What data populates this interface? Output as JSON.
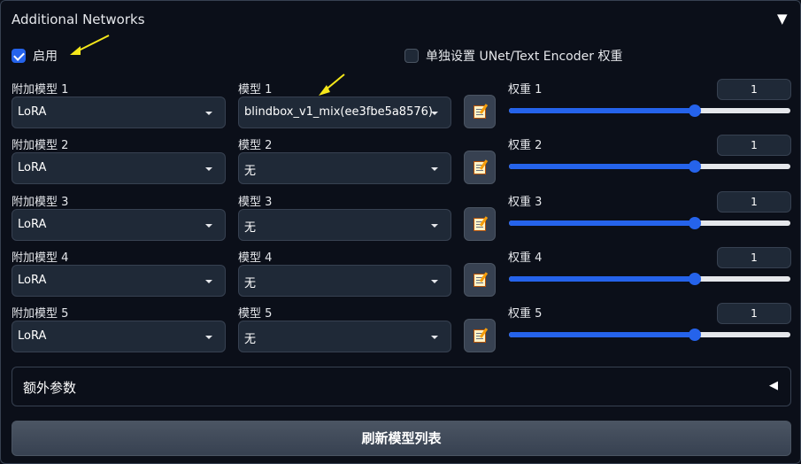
{
  "header": {
    "title": "Additional Networks",
    "collapse_glyph": "▼"
  },
  "enable": {
    "label": "启用",
    "checked": true
  },
  "separate_weights": {
    "label": "单独设置 UNet/Text Encoder 权重",
    "checked": false
  },
  "rows": [
    {
      "type_label": "附加模型 1",
      "type_value": "LoRA",
      "model_label": "模型 1",
      "model_value": "blindbox_v1_mix(ee3fbe5a8576)",
      "weight_label": "权重 1",
      "weight_value": "1",
      "slider_fraction": 0.66
    },
    {
      "type_label": "附加模型 2",
      "type_value": "LoRA",
      "model_label": "模型 2",
      "model_value": "无",
      "weight_label": "权重 2",
      "weight_value": "1",
      "slider_fraction": 0.66
    },
    {
      "type_label": "附加模型 3",
      "type_value": "LoRA",
      "model_label": "模型 3",
      "model_value": "无",
      "weight_label": "权重 3",
      "weight_value": "1",
      "slider_fraction": 0.66
    },
    {
      "type_label": "附加模型 4",
      "type_value": "LoRA",
      "model_label": "模型 4",
      "model_value": "无",
      "weight_label": "权重 4",
      "weight_value": "1",
      "slider_fraction": 0.66
    },
    {
      "type_label": "附加模型 5",
      "type_value": "LoRA",
      "model_label": "模型 5",
      "model_value": "无",
      "weight_label": "权重 5",
      "weight_value": "1",
      "slider_fraction": 0.66
    }
  ],
  "extra_params": {
    "label": "额外参数",
    "glyph": "◀"
  },
  "refresh_button": {
    "label": "刷新模型列表"
  },
  "colors": {
    "accent": "#2563eb",
    "background": "#0b0f19",
    "field": "#1f2937",
    "annotation_arrow": "#f5e71a"
  },
  "icons": {
    "edit": "notepad-pencil-icon",
    "annotation": "yellow-arrow-icon"
  }
}
